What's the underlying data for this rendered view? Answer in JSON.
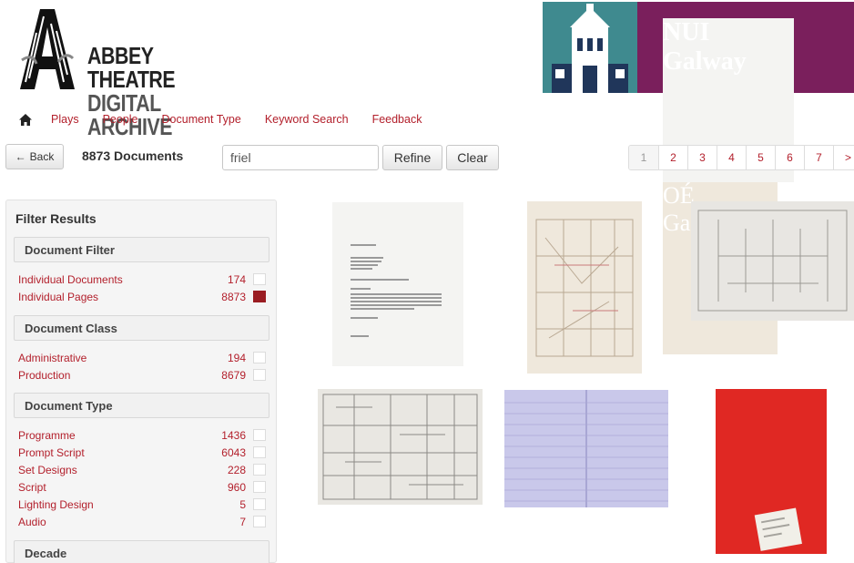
{
  "header": {
    "abbey_logo": {
      "line1": "ABBEY THEATRE",
      "line2": "DIGITAL ARCHIVE"
    },
    "nui_logo": {
      "line1": "NUI Galway",
      "line2": "OÉ Gaillimh"
    }
  },
  "nav": {
    "home_icon": "home-icon",
    "items": [
      "Plays",
      "People",
      "Document Type",
      "Keyword Search",
      "Feedback"
    ]
  },
  "toolbar": {
    "back_label": "Back",
    "doc_count": "8873 Documents",
    "search_value": "friel",
    "refine_label": "Refine",
    "clear_label": "Clear",
    "pages": [
      "1",
      "2",
      "3",
      "4",
      "5",
      "6",
      "7",
      ">"
    ]
  },
  "sidebar": {
    "title": "Filter Results",
    "document_filter": {
      "header": "Document Filter",
      "items": [
        {
          "label": "Individual Documents",
          "count": "174",
          "checked": false
        },
        {
          "label": "Individual Pages",
          "count": "8873",
          "checked": true
        }
      ]
    },
    "document_class": {
      "header": "Document Class",
      "items": [
        {
          "label": "Administrative",
          "count": "194",
          "checked": false
        },
        {
          "label": "Production",
          "count": "8679",
          "checked": false
        }
      ]
    },
    "document_type": {
      "header": "Document Type",
      "items": [
        {
          "label": "Programme",
          "count": "1436",
          "checked": false
        },
        {
          "label": "Prompt Script",
          "count": "6043",
          "checked": false
        },
        {
          "label": "Set Designs",
          "count": "228",
          "checked": false
        },
        {
          "label": "Script",
          "count": "960",
          "checked": false
        },
        {
          "label": "Lighting Design",
          "count": "5",
          "checked": false
        },
        {
          "label": "Audio",
          "count": "7",
          "checked": false
        }
      ]
    },
    "decade": {
      "header": "Decade"
    }
  },
  "colors": {
    "link": "#b3202c",
    "checked": "#9a1c22",
    "nui_purple": "#7a1f5c",
    "nui_teal": "#3f8a8f"
  }
}
